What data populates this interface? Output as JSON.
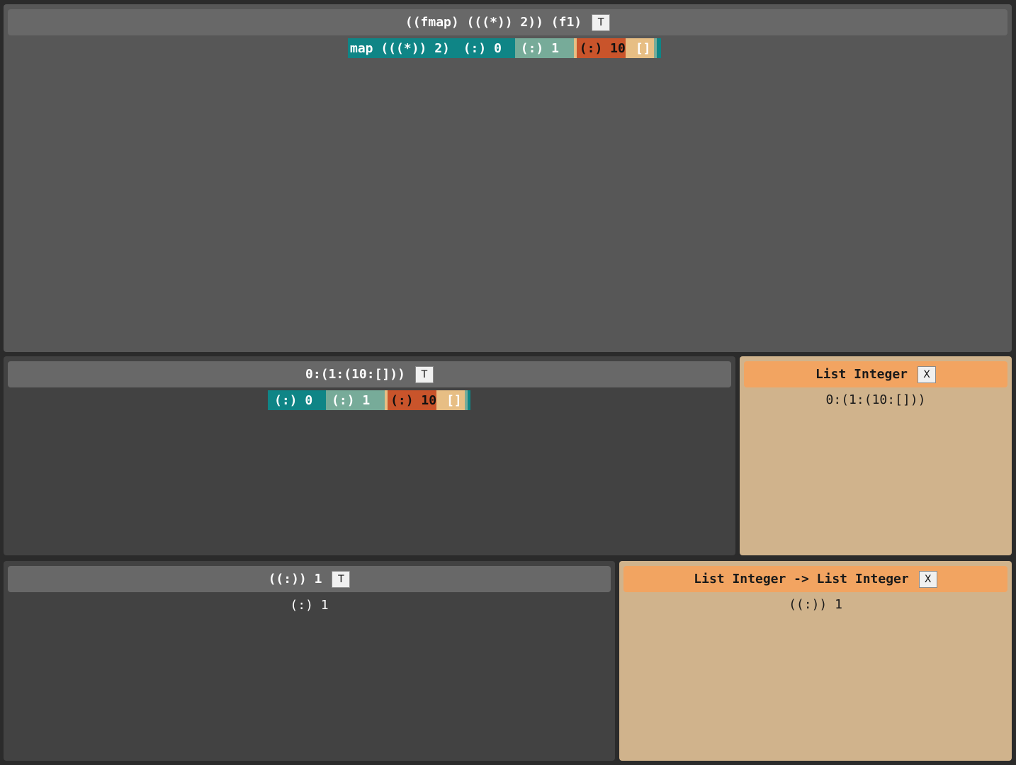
{
  "colors": {
    "teal": "#0f8586",
    "sage": "#77ab99",
    "rust": "#c9542b",
    "peach": "#e7be84",
    "orange_header": "#f2a461",
    "tan_panel": "#d0b38c"
  },
  "panel_top": {
    "title": "((fmap) (((*)) 2)) (f1)",
    "button": "T",
    "expr": {
      "seg_map": "map (((*)) 2) ",
      "seg_0": "(:) 0 ",
      "seg_1": "(:) 1 ",
      "seg_10": "(:) 10",
      "seg_nil": "[]"
    }
  },
  "panel_mid": {
    "title": "0:(1:(10:[]))",
    "button": "T",
    "expr": {
      "seg_0": "(:) 0 ",
      "seg_1": "(:) 1 ",
      "seg_10": "(:) 10",
      "seg_nil": "[]"
    }
  },
  "type_panel_mid": {
    "title": "List Integer",
    "button": "X",
    "value": "0:(1:(10:[]))"
  },
  "panel_bottom": {
    "title": "((:)) 1",
    "button": "T",
    "value": "(:) 1"
  },
  "type_panel_bottom": {
    "title": "List Integer -> List Integer",
    "button": "X",
    "value": "((:)) 1"
  }
}
